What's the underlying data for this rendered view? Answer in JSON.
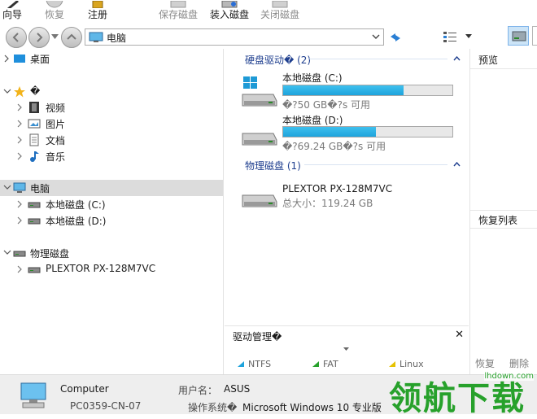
{
  "toolbar": {
    "wizard": "向导",
    "restore": "恢复",
    "register": "注册",
    "save_disk": "保存磁盘",
    "load_disk": "装入磁盘",
    "close_disk": "关闭磁盘"
  },
  "address": {
    "current": "电脑"
  },
  "tree": {
    "desktop": "桌面",
    "favorites": "�",
    "video": "视频",
    "pictures": "图片",
    "documents": "文档",
    "music": "音乐",
    "computer": "电脑",
    "drive_c": "本地磁盘 (C:)",
    "drive_d": "本地磁盘 (D:)",
    "physical": "物理磁盘",
    "plextor": "PLEXTOR PX-128M7VC"
  },
  "center": {
    "hdd_group": "硬盘驱动� (2)",
    "drives": [
      {
        "name": "本地磁盘 (C:)",
        "free": "�?50 GB�?s 可用",
        "used_fraction": 0.71
      },
      {
        "name": "本地磁盘 (D:)",
        "free": "�?69.24 GB�?s 可用",
        "used_fraction": 0.55
      }
    ],
    "physical_group": "物理磁盘 (1)",
    "physical_name": "PLEXTOR PX-128M7VC",
    "physical_size": "总大小：119.24 GB"
  },
  "mgmt": {
    "title": "驱动管理�",
    "close": "✕",
    "legend": [
      {
        "label": "NTFS",
        "color": "#1ea3dc"
      },
      {
        "label": "FAT",
        "color": "#27a12b"
      },
      {
        "label": "Linux",
        "color": "#e6c200"
      }
    ]
  },
  "right": {
    "preview": "预览",
    "recovery_list": "恢复列表",
    "restore": "恢复",
    "delete": "删除"
  },
  "status": {
    "computer_title": "Computer",
    "computer_name": "PC0359-CN-07",
    "user_label": "用户名：",
    "user_value": "ASUS",
    "os_label": "操作系统�",
    "os_value": "Microsoft Windows 10 专业版"
  },
  "watermark": {
    "text": "领航下载",
    "url": "lhdown.com"
  }
}
